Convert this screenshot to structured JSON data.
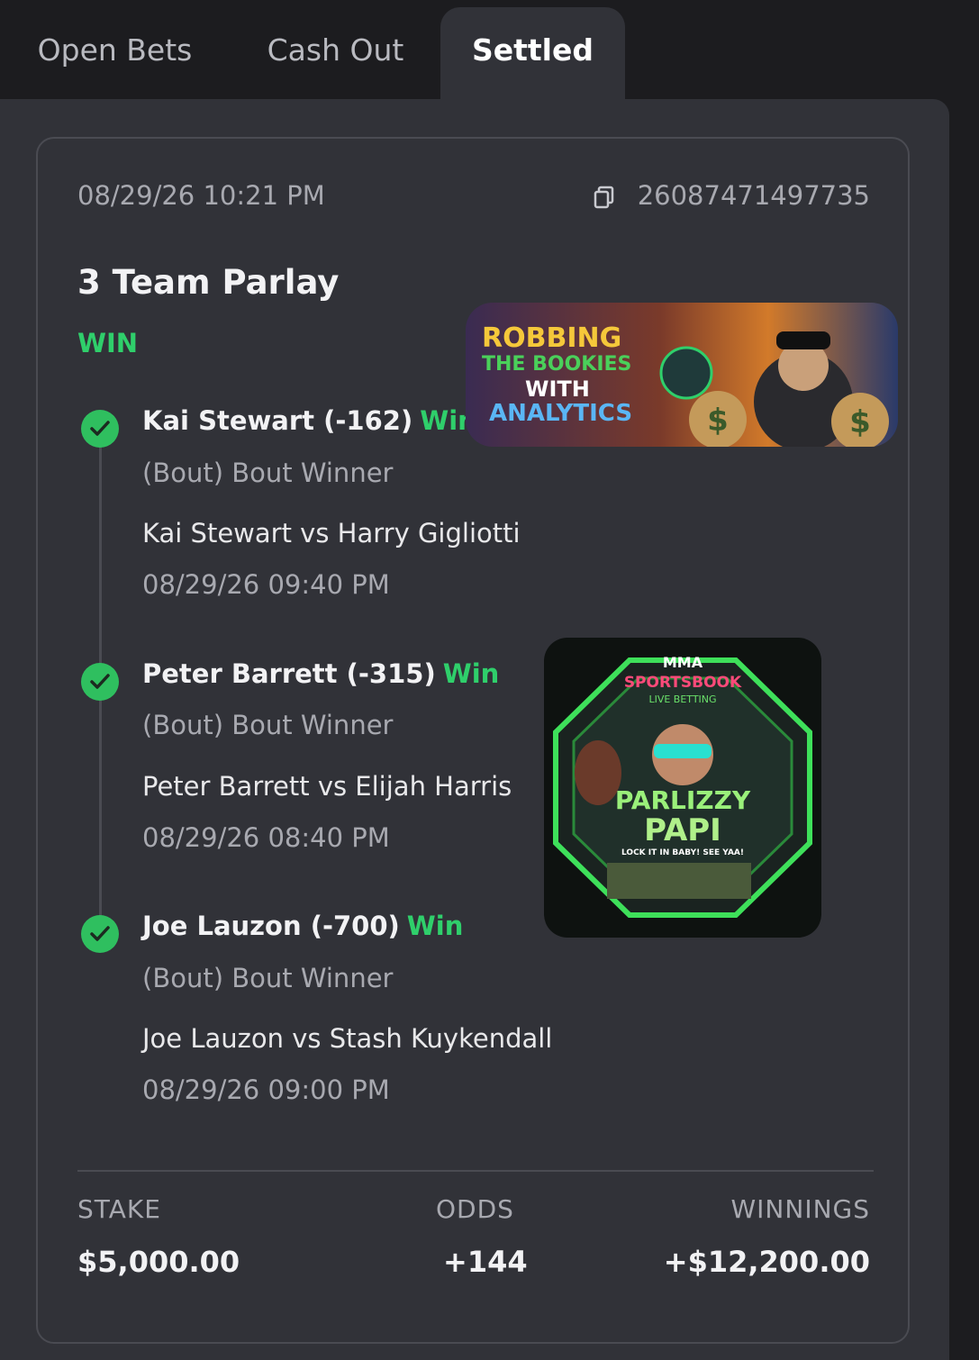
{
  "tabs": [
    {
      "label": "Open Bets"
    },
    {
      "label": "Cash Out"
    },
    {
      "label": "Settled"
    }
  ],
  "bet": {
    "placed_at": "08/29/26  10:21 PM",
    "bet_id": "26087471497735",
    "title": "3 Team Parlay",
    "result": "WIN",
    "legs": [
      {
        "pick": "Kai Stewart (-162)",
        "status": "Win",
        "market": "(Bout) Bout Winner",
        "event": "Kai Stewart vs Harry Gigliotti",
        "date": "08/29/26   09:40 PM"
      },
      {
        "pick": "Peter Barrett (-315)",
        "status": "Win",
        "market": "(Bout) Bout Winner",
        "event": "Peter Barrett vs Elijah Harris",
        "date": "08/29/26   08:40 PM"
      },
      {
        "pick": "Joe Lauzon (-700)",
        "status": "Win",
        "market": "(Bout) Bout Winner",
        "event": "Joe Lauzon vs Stash Kuykendall",
        "date": "08/29/26   09:00 PM"
      }
    ],
    "summary": {
      "stake_label": "STAKE",
      "stake": "$5,000.00",
      "odds_label": "ODDS",
      "odds": "+144",
      "winnings_label": "WINNINGS",
      "winnings": "+$12,200.00"
    }
  },
  "banner": {
    "line1": "ROBBING",
    "line2": "THE BOOKIES",
    "line3": "WITH",
    "line4": "ANALYTICS"
  },
  "logo": {
    "top": "MMA",
    "sub": "SPORTSBOOK",
    "sub2": "LIVE BETTING",
    "name1": "PARLIZZY",
    "name2": "PAPI",
    "tagline": "LOCK IT IN BABY! SEE YAA!"
  },
  "colors": {
    "win_green": "#2fcf6b",
    "panel": "#313238",
    "background": "#1c1c1f"
  }
}
